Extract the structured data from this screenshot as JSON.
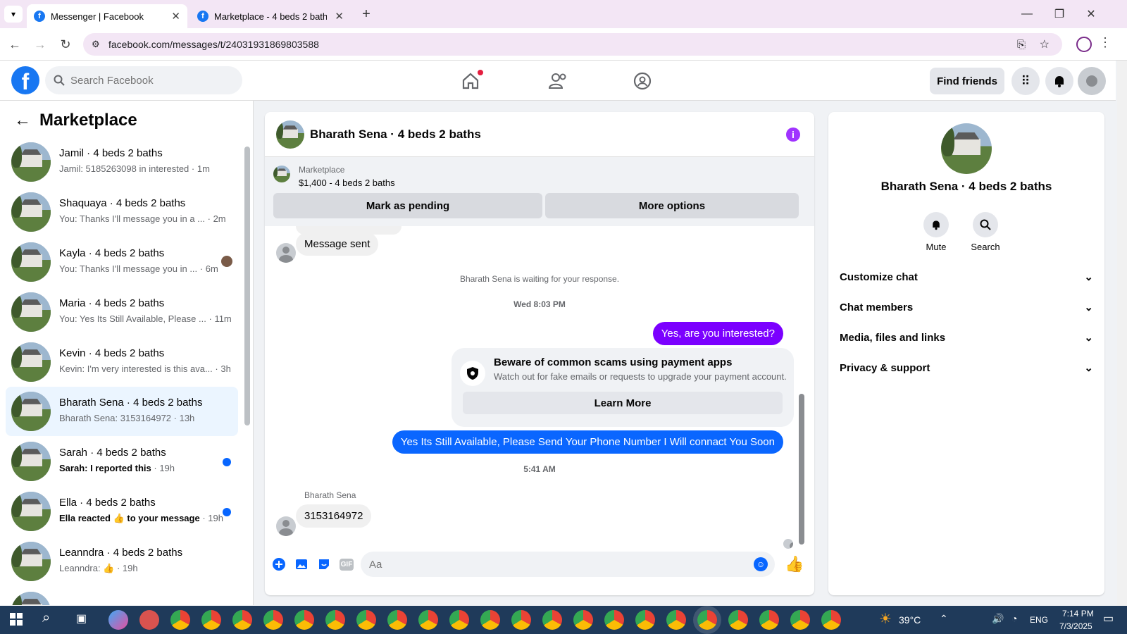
{
  "browser": {
    "tabs": [
      {
        "title": "Messenger | Facebook",
        "active": true
      },
      {
        "title": "Marketplace - 4 beds 2 baths |",
        "active": false
      }
    ],
    "url": "facebook.com/messages/t/24031931869803588"
  },
  "fb_header": {
    "search_placeholder": "Search Facebook",
    "find_friends": "Find friends"
  },
  "left_panel": {
    "title": "Marketplace",
    "conversations": [
      {
        "name": "Jamil · 4 beds 2 baths",
        "preview": "Jamil: 5185263098 in interested",
        "time": "· 1m",
        "unread": false
      },
      {
        "name": "Shaquaya · 4 beds 2 baths",
        "preview": "You: Thanks I'll message you in a ...",
        "time": "· 2m",
        "unread": false
      },
      {
        "name": "Kayla · 4 beds 2 baths",
        "preview": "You: Thanks I'll message you in ...",
        "time": "· 6m",
        "unread": false
      },
      {
        "name": "Maria · 4 beds 2 baths",
        "preview": "You: Yes Its Still Available, Please ...",
        "time": "· 11m",
        "unread": false
      },
      {
        "name": "Kevin · 4 beds 2 baths",
        "preview": "Kevin: I'm very interested is this ava...",
        "time": "· 3h",
        "unread": false
      },
      {
        "name": "Bharath Sena · 4 beds 2 baths",
        "preview": "Bharath Sena: 3153164972",
        "time": "· 13h",
        "unread": false,
        "selected": true
      },
      {
        "name": "Sarah · 4 beds 2 baths",
        "preview": "Sarah: I reported this",
        "time": "· 19h",
        "unread": true
      },
      {
        "name": "Ella · 4 beds 2 baths",
        "preview": "Ella reacted 👍 to your message",
        "time": "· 19h",
        "unread": true
      },
      {
        "name": "Leanndra · 4 beds 2 baths",
        "preview": "Leanndra: 👍",
        "time": "· 19h",
        "unread": false
      }
    ]
  },
  "chat": {
    "title": "Bharath Sena · 4 beds 2 baths",
    "marketplace_label": "Marketplace",
    "listing": "$1,400 - 4 beds 2 baths",
    "mark_pending": "Mark as pending",
    "more_options": "More options",
    "msg_sent": "Message sent",
    "waiting": "Bharath Sena is waiting for your response.",
    "time1": "Wed 8:03 PM",
    "out1": "Yes, are you interested?",
    "scam_title": "Beware of common scams using payment apps",
    "scam_sub": "Watch out for fake emails or requests to upgrade your payment account.",
    "learn_more": "Learn More",
    "out2": "Yes Its Still Available, Please Send Your Phone Number I Will connact You Soon",
    "time2": "5:41 AM",
    "sender": "Bharath Sena",
    "in_msg": "3153164972",
    "input_placeholder": "Aa"
  },
  "right_panel": {
    "name": "Bharath Sena · 4 beds 2 baths",
    "mute": "Mute",
    "search": "Search",
    "rows": [
      "Customize chat",
      "Chat members",
      "Media, files and links",
      "Privacy & support"
    ]
  },
  "taskbar": {
    "weather": "39°C",
    "lang": "ENG",
    "time": "7:14 PM",
    "date": "7/3/2025"
  }
}
